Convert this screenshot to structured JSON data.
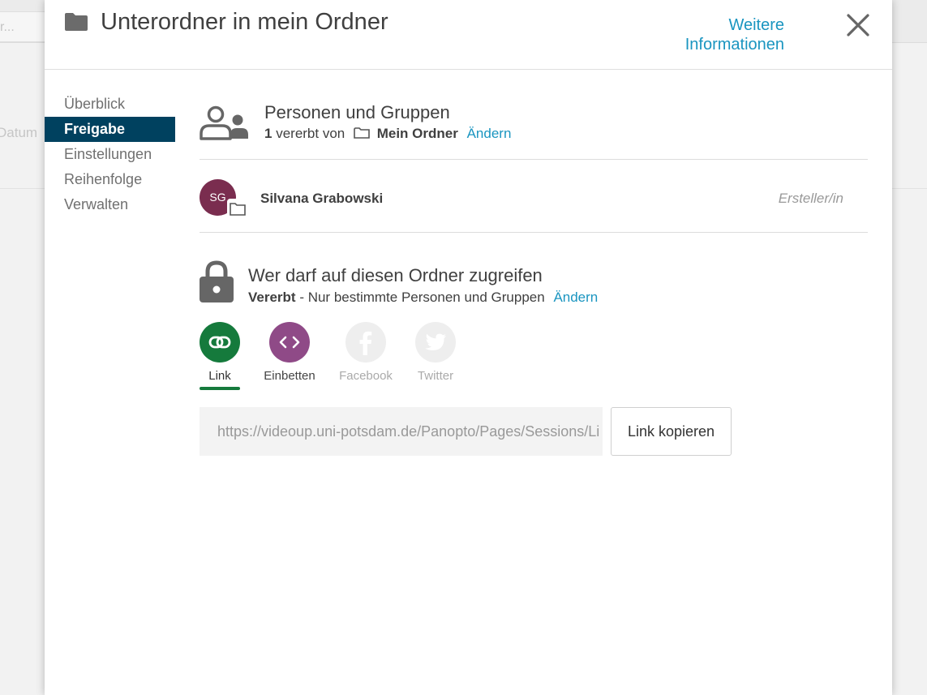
{
  "background": {
    "search_placeholder": "r...",
    "column_label": "Datum"
  },
  "modal": {
    "title": "Unterordner in mein Ordner",
    "title_icon": "folder-icon",
    "more_info": "Weitere Informationen",
    "close_icon": "close-icon"
  },
  "nav": {
    "items": [
      {
        "label": "Überblick"
      },
      {
        "label": "Freigabe",
        "active": true
      },
      {
        "label": "Einstellungen"
      },
      {
        "label": "Reihenfolge"
      },
      {
        "label": "Verwalten"
      }
    ]
  },
  "people": {
    "title": "Personen und Gruppen",
    "count": "1",
    "inherited_text": "vererbt von",
    "folder_name": "Mein Ordner",
    "change": "Ändern",
    "users": [
      {
        "initials": "SG",
        "name": "Silvana Grabowski",
        "role": "Ersteller/in",
        "avatar_color": "#7a2d4f"
      }
    ]
  },
  "access": {
    "title": "Wer darf auf diesen Ordner zugreifen",
    "mode": "Vererbt",
    "separator": " - ",
    "description": "Nur bestimmte Personen und Gruppen",
    "change": "Ändern"
  },
  "share": {
    "tabs": [
      {
        "label": "Link",
        "icon": "link-icon",
        "color": "#157a3c",
        "active": true
      },
      {
        "label": "Einbetten",
        "icon": "embed-icon",
        "color": "#8f4a87"
      },
      {
        "label": "Facebook",
        "icon": "facebook-icon",
        "color": "#eeeeee",
        "disabled": true
      },
      {
        "label": "Twitter",
        "icon": "twitter-icon",
        "color": "#eeeeee",
        "disabled": true
      }
    ],
    "url": "https://videoup.uni-potsdam.de/Panopto/Pages/Sessions/Li",
    "copy_button": "Link kopieren"
  },
  "colors": {
    "accent": "#1a95c0",
    "nav_active": "#00415f"
  }
}
